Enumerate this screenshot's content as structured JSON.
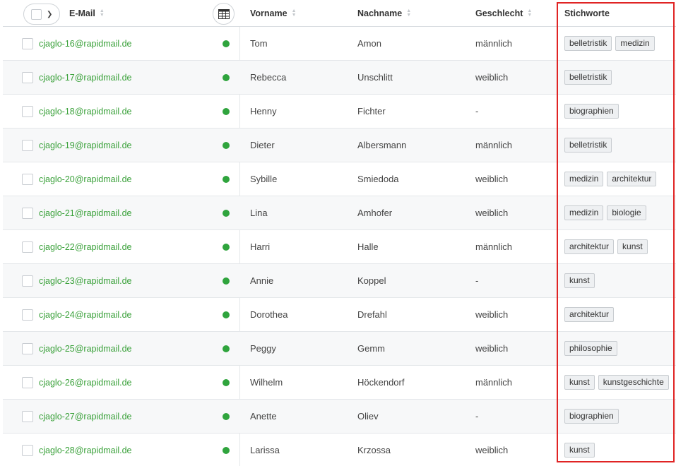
{
  "header": {
    "email": "E-Mail",
    "vorname": "Vorname",
    "nachname": "Nachname",
    "geschlecht": "Geschlecht",
    "stichworte": "Stichworte"
  },
  "icons": {
    "sort": "sort-icon",
    "select_all_chevron": "chevron-down-icon",
    "column_settings": "table-grid-icon",
    "status": "status-dot-icon"
  },
  "colors": {
    "email_link": "#3aa13a",
    "status_active": "#2fa43d",
    "highlight": "#e02424"
  },
  "rows": [
    {
      "email": "cjaglo-16@rapidmail.de",
      "vorname": "Tom",
      "nachname": "Amon",
      "geschlecht": "männlich",
      "tags": [
        "belletristik",
        "medizin"
      ]
    },
    {
      "email": "cjaglo-17@rapidmail.de",
      "vorname": "Rebecca",
      "nachname": "Unschlitt",
      "geschlecht": "weiblich",
      "tags": [
        "belletristik"
      ]
    },
    {
      "email": "cjaglo-18@rapidmail.de",
      "vorname": "Henny",
      "nachname": "Fichter",
      "geschlecht": "-",
      "tags": [
        "biographien"
      ]
    },
    {
      "email": "cjaglo-19@rapidmail.de",
      "vorname": "Dieter",
      "nachname": "Albersmann",
      "geschlecht": "männlich",
      "tags": [
        "belletristik"
      ]
    },
    {
      "email": "cjaglo-20@rapidmail.de",
      "vorname": "Sybille",
      "nachname": "Smiedoda",
      "geschlecht": "weiblich",
      "tags": [
        "medizin",
        "architektur"
      ]
    },
    {
      "email": "cjaglo-21@rapidmail.de",
      "vorname": "Lina",
      "nachname": "Amhofer",
      "geschlecht": "weiblich",
      "tags": [
        "medizin",
        "biologie"
      ]
    },
    {
      "email": "cjaglo-22@rapidmail.de",
      "vorname": "Harri",
      "nachname": "Halle",
      "geschlecht": "männlich",
      "tags": [
        "architektur",
        "kunst"
      ]
    },
    {
      "email": "cjaglo-23@rapidmail.de",
      "vorname": "Annie",
      "nachname": "Koppel",
      "geschlecht": "-",
      "tags": [
        "kunst"
      ]
    },
    {
      "email": "cjaglo-24@rapidmail.de",
      "vorname": "Dorothea",
      "nachname": "Drefahl",
      "geschlecht": "weiblich",
      "tags": [
        "architektur"
      ]
    },
    {
      "email": "cjaglo-25@rapidmail.de",
      "vorname": "Peggy",
      "nachname": "Gemm",
      "geschlecht": "weiblich",
      "tags": [
        "philosophie"
      ]
    },
    {
      "email": "cjaglo-26@rapidmail.de",
      "vorname": "Wilhelm",
      "nachname": "Höckendorf",
      "geschlecht": "männlich",
      "tags": [
        "kunst",
        "kunstgeschichte"
      ]
    },
    {
      "email": "cjaglo-27@rapidmail.de",
      "vorname": "Anette",
      "nachname": "Oliev",
      "geschlecht": "-",
      "tags": [
        "biographien"
      ]
    },
    {
      "email": "cjaglo-28@rapidmail.de",
      "vorname": "Larissa",
      "nachname": "Krzossa",
      "geschlecht": "weiblich",
      "tags": [
        "kunst"
      ]
    }
  ]
}
